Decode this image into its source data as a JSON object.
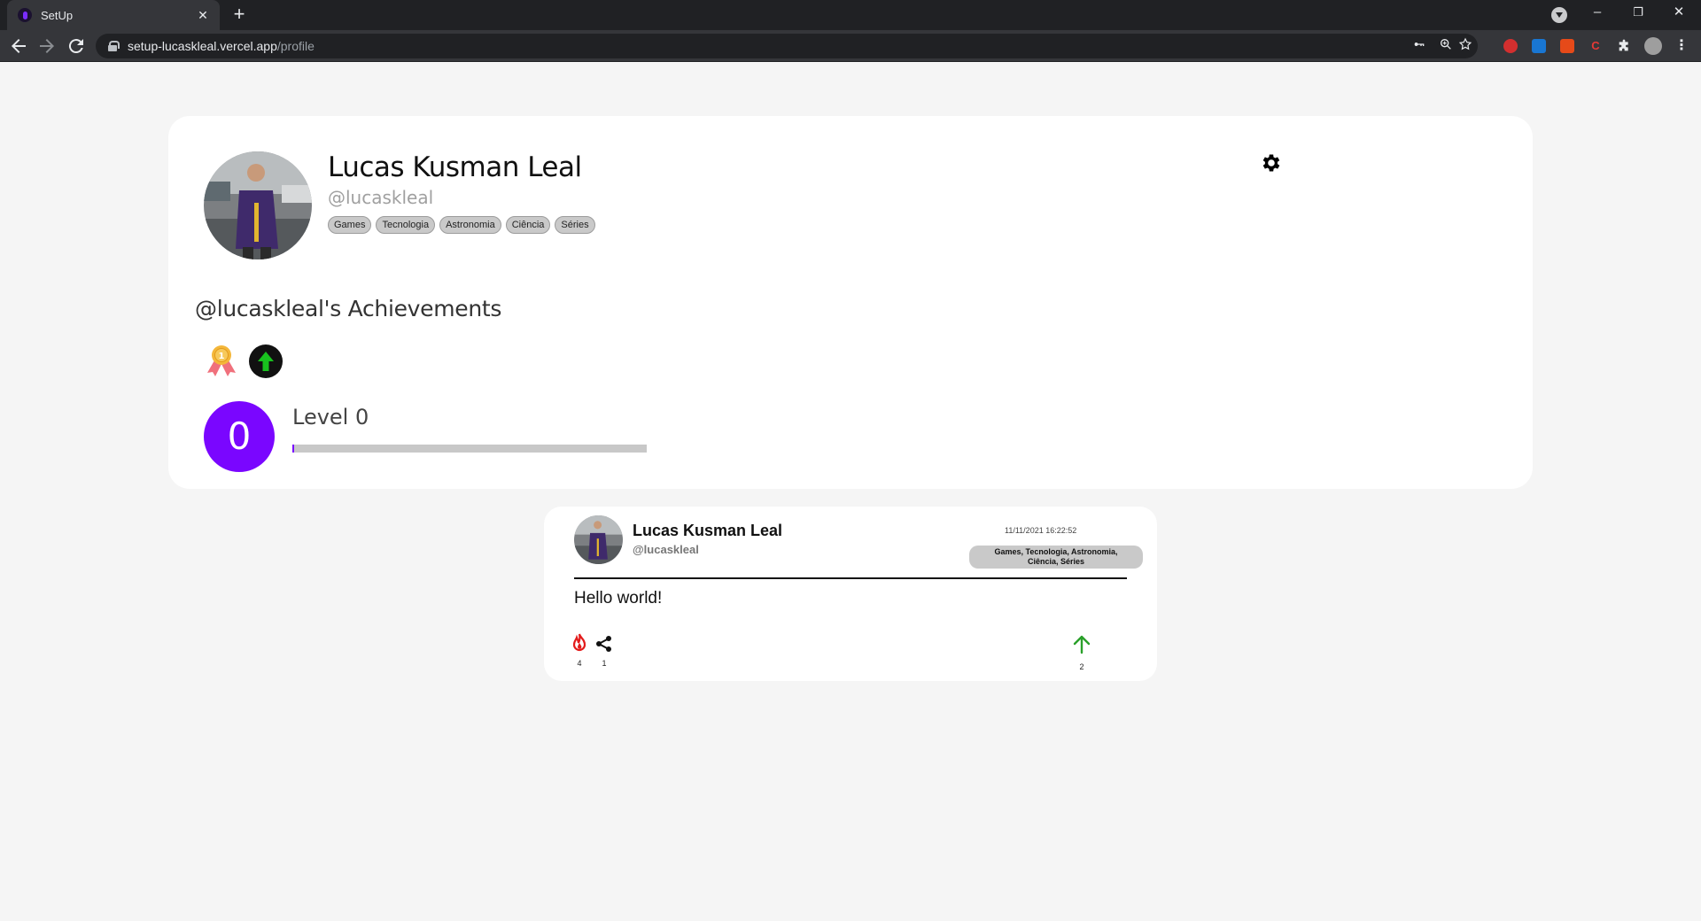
{
  "browser": {
    "tab_title": "SetUp",
    "tab_close": "✕",
    "new_tab": "+",
    "url_host": "setup-lucaskleal.vercel.app",
    "url_path": "/profile",
    "window_controls": {
      "minimize": "–",
      "restore": "❐",
      "close": "✕"
    }
  },
  "profile": {
    "name": "Lucas Kusman Leal",
    "handle": "@lucaskleal",
    "interests": [
      "Games",
      "Tecnologia",
      "Astronomia",
      "Ciência",
      "Séries"
    ],
    "achievements_title": "@lucaskleal's Achievements",
    "achievements": [
      "medal-icon",
      "up-arrow-badge-icon"
    ],
    "level_number": "0",
    "level_label": "Level 0",
    "level_progress": 0.005,
    "accent_color": "#7a06ff"
  },
  "post": {
    "author_name": "Lucas Kusman Leal",
    "author_handle": "@lucaskleal",
    "timestamp": "11/11/2021 16:22:52",
    "tags": "Games, Tecnologia, Astronomia, Ciência, Séries",
    "text": "Hello world!",
    "likes": "4",
    "shares": "1",
    "upvotes": "2"
  }
}
